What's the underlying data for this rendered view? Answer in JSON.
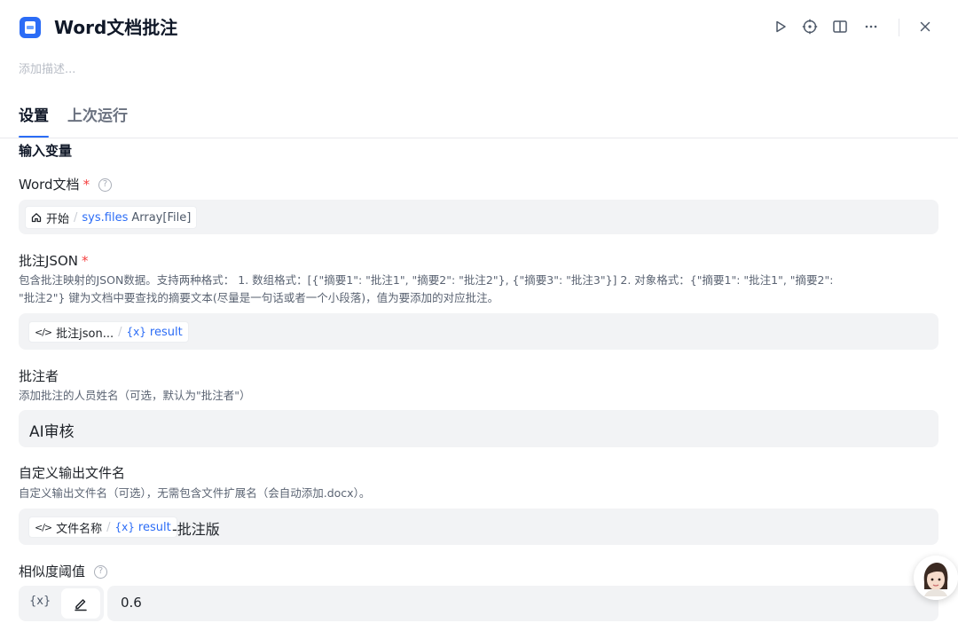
{
  "header": {
    "title": "Word文档批注",
    "actions": [
      "run-icon",
      "locate-icon",
      "book-icon",
      "more-icon",
      "close-icon"
    ]
  },
  "description_placeholder": "添加描述...",
  "tabs": [
    {
      "label": "设置",
      "active": true
    },
    {
      "label": "上次运行",
      "active": false
    }
  ],
  "section_title": "输入变量",
  "fields": {
    "word_doc": {
      "label": "Word文档",
      "required_mark": "*",
      "help": "?",
      "chip": {
        "source": "开始",
        "separator": "/",
        "variable": "sys.files",
        "type": "Array[File]"
      }
    },
    "comment_json": {
      "label": "批注JSON",
      "required_mark": "*",
      "hint_line1": "包含批注映射的JSON数据。支持两种格式： 1. 数组格式：[{\"摘要1\": \"批注1\", \"摘要2\": \"批注2\"}, {\"摘要3\": \"批注3\"}] 2. 对象格式：{\"摘要1\": \"批注1\", \"摘要2\":",
      "hint_line2": "\"批注2\"} 键为文档中要查找的摘要文本(尽量是一句话或者一个小段落)，值为要添加的对应批注。",
      "chip": {
        "source": "批注json...",
        "separator": "/",
        "var_icon": "{x}",
        "variable": "result"
      }
    },
    "annotator": {
      "label": "批注者",
      "hint": "添加批注的人员姓名（可选，默认为\"批注者\"）",
      "value": "AI审核"
    },
    "output_filename": {
      "label": "自定义输出文件名",
      "hint": "自定义输出文件名（可选），无需包含文件扩展名（会自动添加.docx）。",
      "chip": {
        "source": "文件名称",
        "separator": "/",
        "var_icon": "{x}",
        "variable": "result"
      },
      "suffix": "-批注版"
    },
    "similarity": {
      "label": "相似度阈值",
      "help": "?",
      "mode_var_label": "{x}",
      "value": "0.6"
    }
  },
  "colors": {
    "accent": "#2b6cf6",
    "required": "#f53f3f",
    "field_bg": "#f2f3f5"
  }
}
